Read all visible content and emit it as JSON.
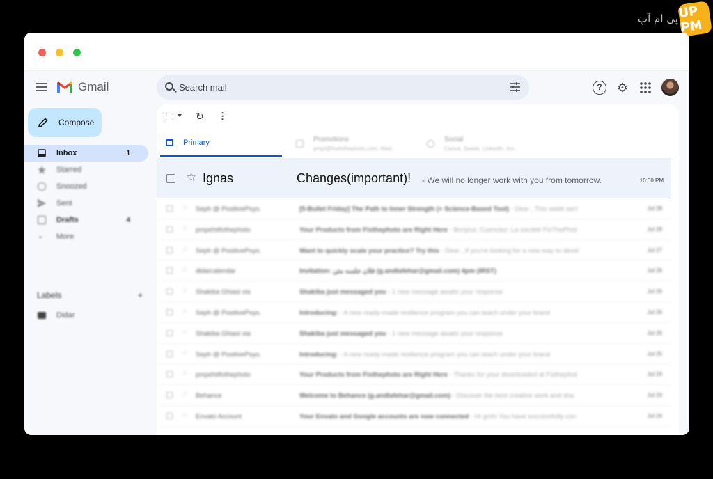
{
  "watermark": {
    "text": "پی ام آپ",
    "logo": "UP PM"
  },
  "app": {
    "name": "Gmail"
  },
  "search": {
    "placeholder": "Search mail"
  },
  "compose": {
    "label": "Compose"
  },
  "nav": [
    {
      "label": "Inbox",
      "count": "1",
      "active": true,
      "icon": "inbox-icon"
    },
    {
      "label": "Starred",
      "count": "",
      "icon": "star-icon"
    },
    {
      "label": "Snoozed",
      "count": "",
      "icon": "clock-icon"
    },
    {
      "label": "Sent",
      "count": "",
      "icon": "send-icon"
    },
    {
      "label": "Drafts",
      "count": "4",
      "icon": "draft-icon"
    },
    {
      "label": "More",
      "count": "",
      "icon": "chevron-down-icon"
    }
  ],
  "labels": {
    "title": "Labels",
    "add": "+",
    "items": [
      {
        "label": "Didar"
      }
    ]
  },
  "tabs": {
    "primary": "Primary",
    "promotions": {
      "label": "Promotions",
      "sub": "pmpl@thefothephoto.com, Wed..."
    },
    "social": {
      "label": "Social",
      "sub": "Canva, Seeek, LinkedIn, Ins..."
    }
  },
  "highlight": {
    "sender": "Ignas",
    "subject": "Changes(important)!",
    "snippet": "- We will no longer work with you from tomorrow.",
    "time": "10:00 PM"
  },
  "emails": [
    {
      "sender": "Seph @ PositivePsyo.",
      "subject": "[5-Bullet Friday] The Path to Inner Strength (+ Science-Based Tool)",
      "snippet": "- Dear , This week we'r",
      "date": "Jul 28"
    },
    {
      "sender": "pmpehitfothephoto",
      "subject": "Your Products from Fixthephoto are Right Here",
      "snippet": "- Bonjour, Cuenciez: La société FixThePhot",
      "date": "Jul 28"
    },
    {
      "sender": "Seph @ PositivePsyo.",
      "subject": "Want to quickly scale your practice? Try this",
      "snippet": "- Dear , If you're looking for a new way to devel",
      "date": "Jul 27"
    },
    {
      "sender": "didarcalendar",
      "subject": "Invitation: فلان جلسه متن (g.andlafehar@gmail.com) 4pm (IRST)",
      "snippet": "",
      "date": "Jul 26"
    },
    {
      "sender": "Shakiba Ghiasi via",
      "subject": "Shakiba just messaged you",
      "snippet": "- 1 new message awaits your response",
      "date": "Jul 26"
    },
    {
      "sender": "Seph @ PositivePsyo.",
      "subject": "Introducing:",
      "snippet": "- A new ready-made resilience program you can teach under your brand",
      "date": "Jul 26"
    },
    {
      "sender": "Shakiba Ghiasi via",
      "subject": "Shakiba just messaged you",
      "snippet": "- 1 new message awaits your response",
      "date": "Jul 26"
    },
    {
      "sender": "Seph @ PositivePsyo.",
      "subject": "Introducing:",
      "snippet": "- A new ready-made resilience program you can teach under your brand",
      "date": "Jul 25"
    },
    {
      "sender": "pmpehitfothephoto",
      "subject": "Your Products from Fixthephoto are Right Here",
      "snippet": "- Thanks for your downloaded at Fixthephot",
      "date": "Jul 24"
    },
    {
      "sender": "Behance",
      "subject": "Welcome to Behance (g.andlafehar@gmail.com)",
      "snippet": "- Discover the best creative work and sha",
      "date": "Jul 24"
    },
    {
      "sender": "Envato Account",
      "subject": "Your Envato and Google accounts are now connected",
      "snippet": "- Hi gmhi You have successfully con",
      "date": "Jul 24"
    }
  ],
  "colors": {
    "accent": "#0b57d0",
    "compose_bg": "#c2e7ff",
    "active_nav": "#d3e3fd",
    "highlight_row": "#eef2fa"
  }
}
